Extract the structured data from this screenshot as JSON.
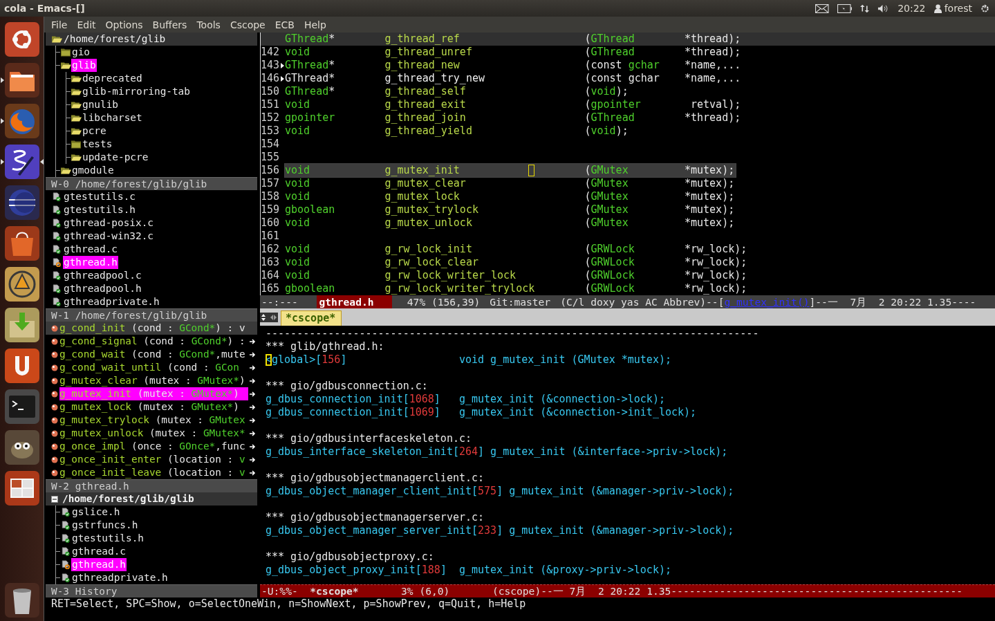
{
  "window": {
    "title": "cola - Emacs-[]"
  },
  "panel": {
    "clock": "20:22",
    "user": "forest"
  },
  "launcher": [
    {
      "kind": "logo",
      "running": false,
      "focused": false
    },
    {
      "kind": "files",
      "running": true,
      "focused": false
    },
    {
      "kind": "browser",
      "running": true,
      "focused": false
    },
    {
      "kind": "editor",
      "running": true,
      "focused": true
    },
    {
      "kind": "ide",
      "running": false,
      "focused": false
    },
    {
      "kind": "store",
      "running": false,
      "focused": false
    },
    {
      "kind": "vector",
      "running": false,
      "focused": false
    },
    {
      "kind": "updates",
      "running": false,
      "focused": false
    },
    {
      "kind": "cloud",
      "running": false,
      "focused": false
    },
    {
      "kind": "terminal",
      "running": false,
      "focused": false
    },
    {
      "kind": "gimp",
      "running": false,
      "focused": false
    },
    {
      "kind": "workspaces",
      "running": false,
      "focused": false
    },
    {
      "kind": "trash",
      "running": false,
      "focused": false
    }
  ],
  "menu": [
    "File",
    "Edit",
    "Options",
    "Buffers",
    "Tools",
    "Cscope",
    "ECB",
    "Help"
  ],
  "ecb": {
    "directories": {
      "path": "/home/forest/glib",
      "children": [
        {
          "name": "gio",
          "kind": "closed",
          "selected": false
        },
        {
          "name": "glib",
          "kind": "open",
          "selected": true,
          "children": [
            {
              "name": "deprecated",
              "kind": "open",
              "selected": false
            },
            {
              "name": "glib-mirroring-tab",
              "kind": "open",
              "selected": false
            },
            {
              "name": "gnulib",
              "kind": "open",
              "selected": false
            },
            {
              "name": "libcharset",
              "kind": "open",
              "selected": false
            },
            {
              "name": "pcre",
              "kind": "open",
              "selected": false
            },
            {
              "name": "tests",
              "kind": "closed",
              "selected": false
            },
            {
              "name": "update-pcre",
              "kind": "open",
              "selected": false
            }
          ]
        },
        {
          "name": "gmodule",
          "kind": "open",
          "selected": false
        }
      ]
    },
    "directories_mode": "W-0 /home/forest/glib/glib",
    "sources": [
      {
        "name": "gtestutils.c",
        "kind": "check",
        "selected": false
      },
      {
        "name": "gtestutils.h",
        "kind": "check",
        "selected": false
      },
      {
        "name": "gthread-posix.c",
        "kind": "check",
        "selected": false
      },
      {
        "name": "gthread-win32.c",
        "kind": "check",
        "selected": false
      },
      {
        "name": "gthread.c",
        "kind": "check",
        "selected": false
      },
      {
        "name": "gthread.h",
        "kind": "ring",
        "selected": true
      },
      {
        "name": "gthreadpool.c",
        "kind": "check",
        "selected": false
      },
      {
        "name": "gthreadpool.h",
        "kind": "check",
        "selected": false
      },
      {
        "name": "gthreadprivate.h",
        "kind": "check",
        "selected": false
      }
    ],
    "sources_mode": "W-1 /home/forest/glib/glib",
    "methods": [
      {
        "name": "g_cond_init",
        "open": " (cond : ",
        "type": "GCond*",
        "rest": ") : v",
        "current": true,
        "selected": false,
        "truncated": false
      },
      {
        "name": "g_cond_signal",
        "open": " (cond : ",
        "type": "GCond*",
        "rest": ") :",
        "current": false,
        "selected": false,
        "truncated": true
      },
      {
        "name": "g_cond_wait",
        "open": " (cond : ",
        "type": "GCond*",
        "rest": ",mute",
        "current": false,
        "selected": false,
        "truncated": true
      },
      {
        "name": "g_cond_wait_until",
        "open": " (cond : ",
        "type": "GCon",
        "current": false,
        "selected": false,
        "truncated": true
      },
      {
        "name": "g_mutex_clear",
        "open": " (mutex : ",
        "type": "GMutex*",
        "rest": ")",
        "current": false,
        "selected": false,
        "truncated": true
      },
      {
        "name": "g_mutex_init",
        "open": " (mutex : ",
        "type": "GMutex*",
        "rest": ")",
        "current": false,
        "selected": true,
        "truncated": true
      },
      {
        "name": "g_mutex_lock",
        "open": " (mutex : ",
        "type": "GMutex*",
        "rest": ")",
        "current": false,
        "selected": false,
        "truncated": true
      },
      {
        "name": "g_mutex_trylock",
        "open": " (mutex : ",
        "type": "GMutex",
        "current": false,
        "selected": false,
        "truncated": true
      },
      {
        "name": "g_mutex_unlock",
        "open": " (mutex : ",
        "type": "GMutex*",
        "current": false,
        "selected": false,
        "truncated": true
      },
      {
        "name": "g_once_impl",
        "open": " (once : ",
        "type": "GOnce*",
        "rest": ",func",
        "current": false,
        "selected": false,
        "truncated": true
      },
      {
        "name": "g_once_init_enter",
        "open": " (location : ",
        "type": "v",
        "current": false,
        "selected": false,
        "truncated": true
      },
      {
        "name": "g_once_init_leave",
        "open": " (location : ",
        "type": "v",
        "current": false,
        "selected": false,
        "truncated": true
      }
    ],
    "methods_mode": "W-2 gthread.h",
    "history": {
      "path": "/home/forest/glib/glib",
      "expanded": true,
      "children": [
        {
          "name": "gslice.h",
          "kind": "check",
          "selected": false
        },
        {
          "name": "gstrfuncs.h",
          "kind": "check",
          "selected": false
        },
        {
          "name": "gtestutils.h",
          "kind": "check",
          "selected": false
        },
        {
          "name": "gthread.c",
          "kind": "check",
          "selected": false
        },
        {
          "name": "gthread.h",
          "kind": "ring",
          "selected": true
        },
        {
          "name": "gthreadprivate.h",
          "kind": "check",
          "selected": false
        }
      ]
    },
    "history_mode": "W-3 History"
  },
  "editor": {
    "header_line": {
      "type": "GThread",
      "pointer": "*",
      "name": "g_thread_ref",
      "args": [
        {
          "text": "(",
          "kind": "plain"
        },
        {
          "text": "GThread",
          "kind": "type"
        }
      ],
      "tail": "*thread);"
    },
    "lines": [
      {
        "number": "142",
        "fold": false,
        "current": false,
        "fontified": true,
        "type": "void",
        "name": "g_thread_unref",
        "args": [
          {
            "text": "(",
            "kind": "plain"
          },
          {
            "text": "GThread",
            "kind": "type"
          }
        ],
        "tail": "*thread);"
      },
      {
        "number": "143",
        "fold": true,
        "current": false,
        "fontified": true,
        "type": "GThread",
        "pointer": "*",
        "name": "g_thread_new",
        "args": [
          {
            "text": "(const ",
            "kind": "plain"
          },
          {
            "text": "gchar",
            "kind": "type"
          }
        ],
        "tail": "*name,..."
      },
      {
        "number": "146",
        "fold": true,
        "current": false,
        "fontified": false,
        "type": "GThread",
        "pointer": "*",
        "name": "g_thread_try_new",
        "args": [
          {
            "text": "(const ",
            "kind": "plain"
          },
          {
            "text": "gchar",
            "kind": "type"
          }
        ],
        "tail": "*name,..."
      },
      {
        "number": "150",
        "fold": false,
        "current": false,
        "fontified": true,
        "type": "GThread",
        "pointer": "*",
        "name": "g_thread_self",
        "args": [
          {
            "text": "(",
            "kind": "plain"
          },
          {
            "text": "void",
            "kind": "type"
          },
          {
            "text": ");",
            "kind": "plain"
          }
        ]
      },
      {
        "number": "151",
        "fold": false,
        "current": false,
        "fontified": true,
        "type": "void",
        "name": "g_thread_exit",
        "args": [
          {
            "text": "(",
            "kind": "plain"
          },
          {
            "text": "gpointer",
            "kind": "type"
          }
        ],
        "tail": " retval);"
      },
      {
        "number": "152",
        "fold": false,
        "current": false,
        "fontified": true,
        "type": "gpointer",
        "name": "g_thread_join",
        "args": [
          {
            "text": "(",
            "kind": "plain"
          },
          {
            "text": "GThread",
            "kind": "type"
          }
        ],
        "tail": "*thread);"
      },
      {
        "number": "153",
        "fold": false,
        "current": false,
        "fontified": true,
        "type": "void",
        "name": "g_thread_yield",
        "args": [
          {
            "text": "(",
            "kind": "plain"
          },
          {
            "text": "void",
            "kind": "type"
          },
          {
            "text": ");",
            "kind": "plain"
          }
        ]
      },
      {
        "number": "154",
        "fold": false,
        "current": false
      },
      {
        "number": "155",
        "fold": false,
        "current": false
      },
      {
        "number": "156",
        "fold": false,
        "current": true,
        "fontified": true,
        "type": "void",
        "name": "g_mutex_init",
        "args": [
          {
            "text": "(",
            "kind": "plain"
          },
          {
            "text": "GMutex",
            "kind": "type"
          }
        ],
        "tail": "*mutex);"
      },
      {
        "number": "157",
        "fold": false,
        "current": false,
        "fontified": true,
        "type": "void",
        "name": "g_mutex_clear",
        "args": [
          {
            "text": "(",
            "kind": "plain"
          },
          {
            "text": "GMutex",
            "kind": "type"
          }
        ],
        "tail": "*mutex);"
      },
      {
        "number": "158",
        "fold": false,
        "current": false,
        "fontified": true,
        "type": "void",
        "name": "g_mutex_lock",
        "args": [
          {
            "text": "(",
            "kind": "plain"
          },
          {
            "text": "GMutex",
            "kind": "type"
          }
        ],
        "tail": "*mutex);"
      },
      {
        "number": "159",
        "fold": false,
        "current": false,
        "fontified": true,
        "type": "gboolean",
        "name": "g_mutex_trylock",
        "args": [
          {
            "text": "(",
            "kind": "plain"
          },
          {
            "text": "GMutex",
            "kind": "type"
          }
        ],
        "tail": "*mutex);"
      },
      {
        "number": "160",
        "fold": false,
        "current": false,
        "fontified": true,
        "type": "void",
        "name": "g_mutex_unlock",
        "args": [
          {
            "text": "(",
            "kind": "plain"
          },
          {
            "text": "GMutex",
            "kind": "type"
          }
        ],
        "tail": "*mutex);"
      },
      {
        "number": "161",
        "fold": false,
        "current": false
      },
      {
        "number": "162",
        "fold": false,
        "current": false,
        "fontified": true,
        "type": "void",
        "name": "g_rw_lock_init",
        "args": [
          {
            "text": "(",
            "kind": "plain"
          },
          {
            "text": "GRWLock",
            "kind": "type"
          }
        ],
        "tail": "*rw_lock);"
      },
      {
        "number": "163",
        "fold": false,
        "current": false,
        "fontified": true,
        "type": "void",
        "name": "g_rw_lock_clear",
        "args": [
          {
            "text": "(",
            "kind": "plain"
          },
          {
            "text": "GRWLock",
            "kind": "type"
          }
        ],
        "tail": "*rw_lock);"
      },
      {
        "number": "164",
        "fold": false,
        "current": false,
        "fontified": true,
        "type": "void",
        "name": "g_rw_lock_writer_lock",
        "args": [
          {
            "text": "(",
            "kind": "plain"
          },
          {
            "text": "GRWLock",
            "kind": "type"
          }
        ],
        "tail": "*rw_lock);"
      },
      {
        "number": "165",
        "fold": false,
        "current": false,
        "fontified": true,
        "type": "gboolean",
        "name": "g_rw_lock_writer_trylock",
        "args": [
          {
            "text": "(",
            "kind": "plain"
          },
          {
            "text": "GRWLock",
            "kind": "type"
          }
        ],
        "tail": "*rw_lock);"
      }
    ],
    "mode_line": {
      "status": "--:---",
      "buffer": "gthread.h",
      "position": "47% (156,39)",
      "vc": "Git:master",
      "modes": "(C/l doxy yas AC Abbrev)--[",
      "function": "g_mutex_init()",
      "tail": "]--一  7月  2 20:22 1.35----"
    }
  },
  "tabs": [
    {
      "label": "*cscope*",
      "selected": true
    }
  ],
  "cscope": {
    "lines": [
      {
        "kind": "rule",
        "text": "-------------------------------------------------------------------------------"
      },
      {
        "kind": "file",
        "text": "*** glib/gthread.h:"
      },
      {
        "kind": "match",
        "function": "<global>",
        "open": "[",
        "line": "156",
        "close": "]",
        "code": "void g_mutex_init (GMutex *mutex);",
        "cursor": true
      },
      {
        "kind": "blank"
      },
      {
        "kind": "file",
        "text": "*** gio/gdbusconnection.c:"
      },
      {
        "kind": "match",
        "function": "g_dbus_connection_init",
        "open": "[",
        "line": "1068",
        "close": "]",
        "code": "g_mutex_init (&connection->lock);",
        "cursor": false
      },
      {
        "kind": "match",
        "function": "g_dbus_connection_init",
        "open": "[",
        "line": "1069",
        "close": "]",
        "code": "g_mutex_init (&connection->init_lock);",
        "cursor": false
      },
      {
        "kind": "blank"
      },
      {
        "kind": "file",
        "text": "*** gio/gdbusinterfaceskeleton.c:"
      },
      {
        "kind": "match",
        "function": "g_dbus_interface_skeleton_init",
        "open": "[",
        "line": "264",
        "close": "]",
        "code": "g_mutex_init (&interface->priv->lock);",
        "cursor": false
      },
      {
        "kind": "blank"
      },
      {
        "kind": "file",
        "text": "*** gio/gdbusobjectmanagerclient.c:"
      },
      {
        "kind": "match",
        "function": "g_dbus_object_manager_client_init",
        "open": "[",
        "line": "575",
        "close": "]",
        "code": "g_mutex_init (&manager->priv->lock);",
        "cursor": false
      },
      {
        "kind": "blank"
      },
      {
        "kind": "file",
        "text": "*** gio/gdbusobjectmanagerserver.c:"
      },
      {
        "kind": "match",
        "function": "g_dbus_object_manager_server_init",
        "open": "[",
        "line": "233",
        "close": "]",
        "code": "g_mutex_init (&manager->priv->lock);",
        "cursor": false
      },
      {
        "kind": "blank"
      },
      {
        "kind": "file",
        "text": "*** gio/gdbusobjectproxy.c:"
      },
      {
        "kind": "match",
        "function": "g_dbus_object_proxy_init",
        "open": "[",
        "line": "188",
        "close": "]",
        "code": "g_mutex_init (&proxy->priv->lock);",
        "cursor": false
      }
    ],
    "mode_line": {
      "status": "-U:%%-",
      "buffer": "*cscope*",
      "position": "3% (6,0)",
      "modes": "(cscope)--一",
      "tail": "7月  2 20:22 1.35------------------------------------------------"
    }
  },
  "echo": "RET=Select, SPC=Show, o=SelectOneWin, n=ShowNext, p=ShowPrev, q=Quit, h=Help"
}
